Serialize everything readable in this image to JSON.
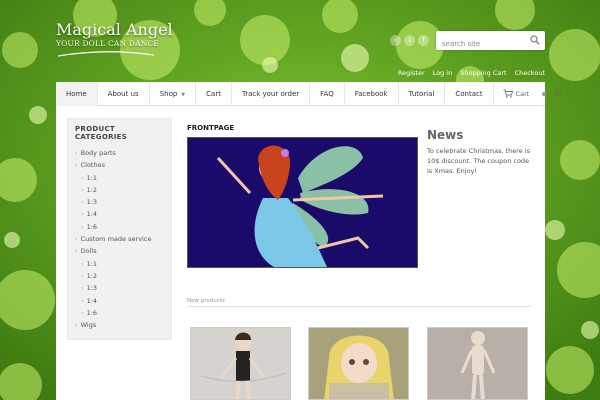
{
  "brand": {
    "title": "Magical Angel",
    "subtitle": "YOUR DOLL CAN DANCE"
  },
  "colors": {
    "background": "#5a9a1e",
    "panel": "#ffffff",
    "sidebar": "#f1f1f1",
    "banner": "#1a0a6a"
  },
  "social": [
    {
      "icon": "rss-icon",
      "glyph": "r"
    },
    {
      "icon": "twitter-icon",
      "glyph": "t"
    },
    {
      "icon": "facebook-icon",
      "glyph": "f"
    }
  ],
  "search": {
    "placeholder": "search site"
  },
  "user_links": [
    "Register",
    "Log in",
    "Shopping Cart",
    "Checkout"
  ],
  "nav": {
    "items": [
      "Home",
      "About us",
      "Shop",
      "Cart",
      "Track your order",
      "FAQ",
      "Facebook",
      "Tutorial",
      "Contact"
    ],
    "cart_label": "Cart",
    "cart_total": "$0"
  },
  "sidebar": {
    "title": "PRODUCT CATEGORIES",
    "categories": [
      {
        "label": "Body parts",
        "level": 0
      },
      {
        "label": "Clothes",
        "level": 0
      },
      {
        "label": "1:1",
        "level": 1
      },
      {
        "label": "1:2",
        "level": 1
      },
      {
        "label": "1:3",
        "level": 1
      },
      {
        "label": "1:4",
        "level": 1
      },
      {
        "label": "1:6",
        "level": 1
      },
      {
        "label": "Custom made service",
        "level": 0
      },
      {
        "label": "Dolls",
        "level": 0
      },
      {
        "label": "1:1",
        "level": 1
      },
      {
        "label": "1:2",
        "level": 1
      },
      {
        "label": "1:3",
        "level": 1
      },
      {
        "label": "1:4",
        "level": 1
      },
      {
        "label": "1:6",
        "level": 1
      },
      {
        "label": "Wigs",
        "level": 0
      }
    ]
  },
  "content": {
    "frontpage_title": "FRONTPAGE",
    "news_title": "News",
    "news_text": "To celebrate Christmas, there is 10$ discount. The coupon code is Xmas. Enjoy!",
    "new_products_label": "New products"
  },
  "products": [
    {
      "name": "product-doll-dark-outfit"
    },
    {
      "name": "product-doll-blonde"
    },
    {
      "name": "product-doll-body"
    }
  ]
}
